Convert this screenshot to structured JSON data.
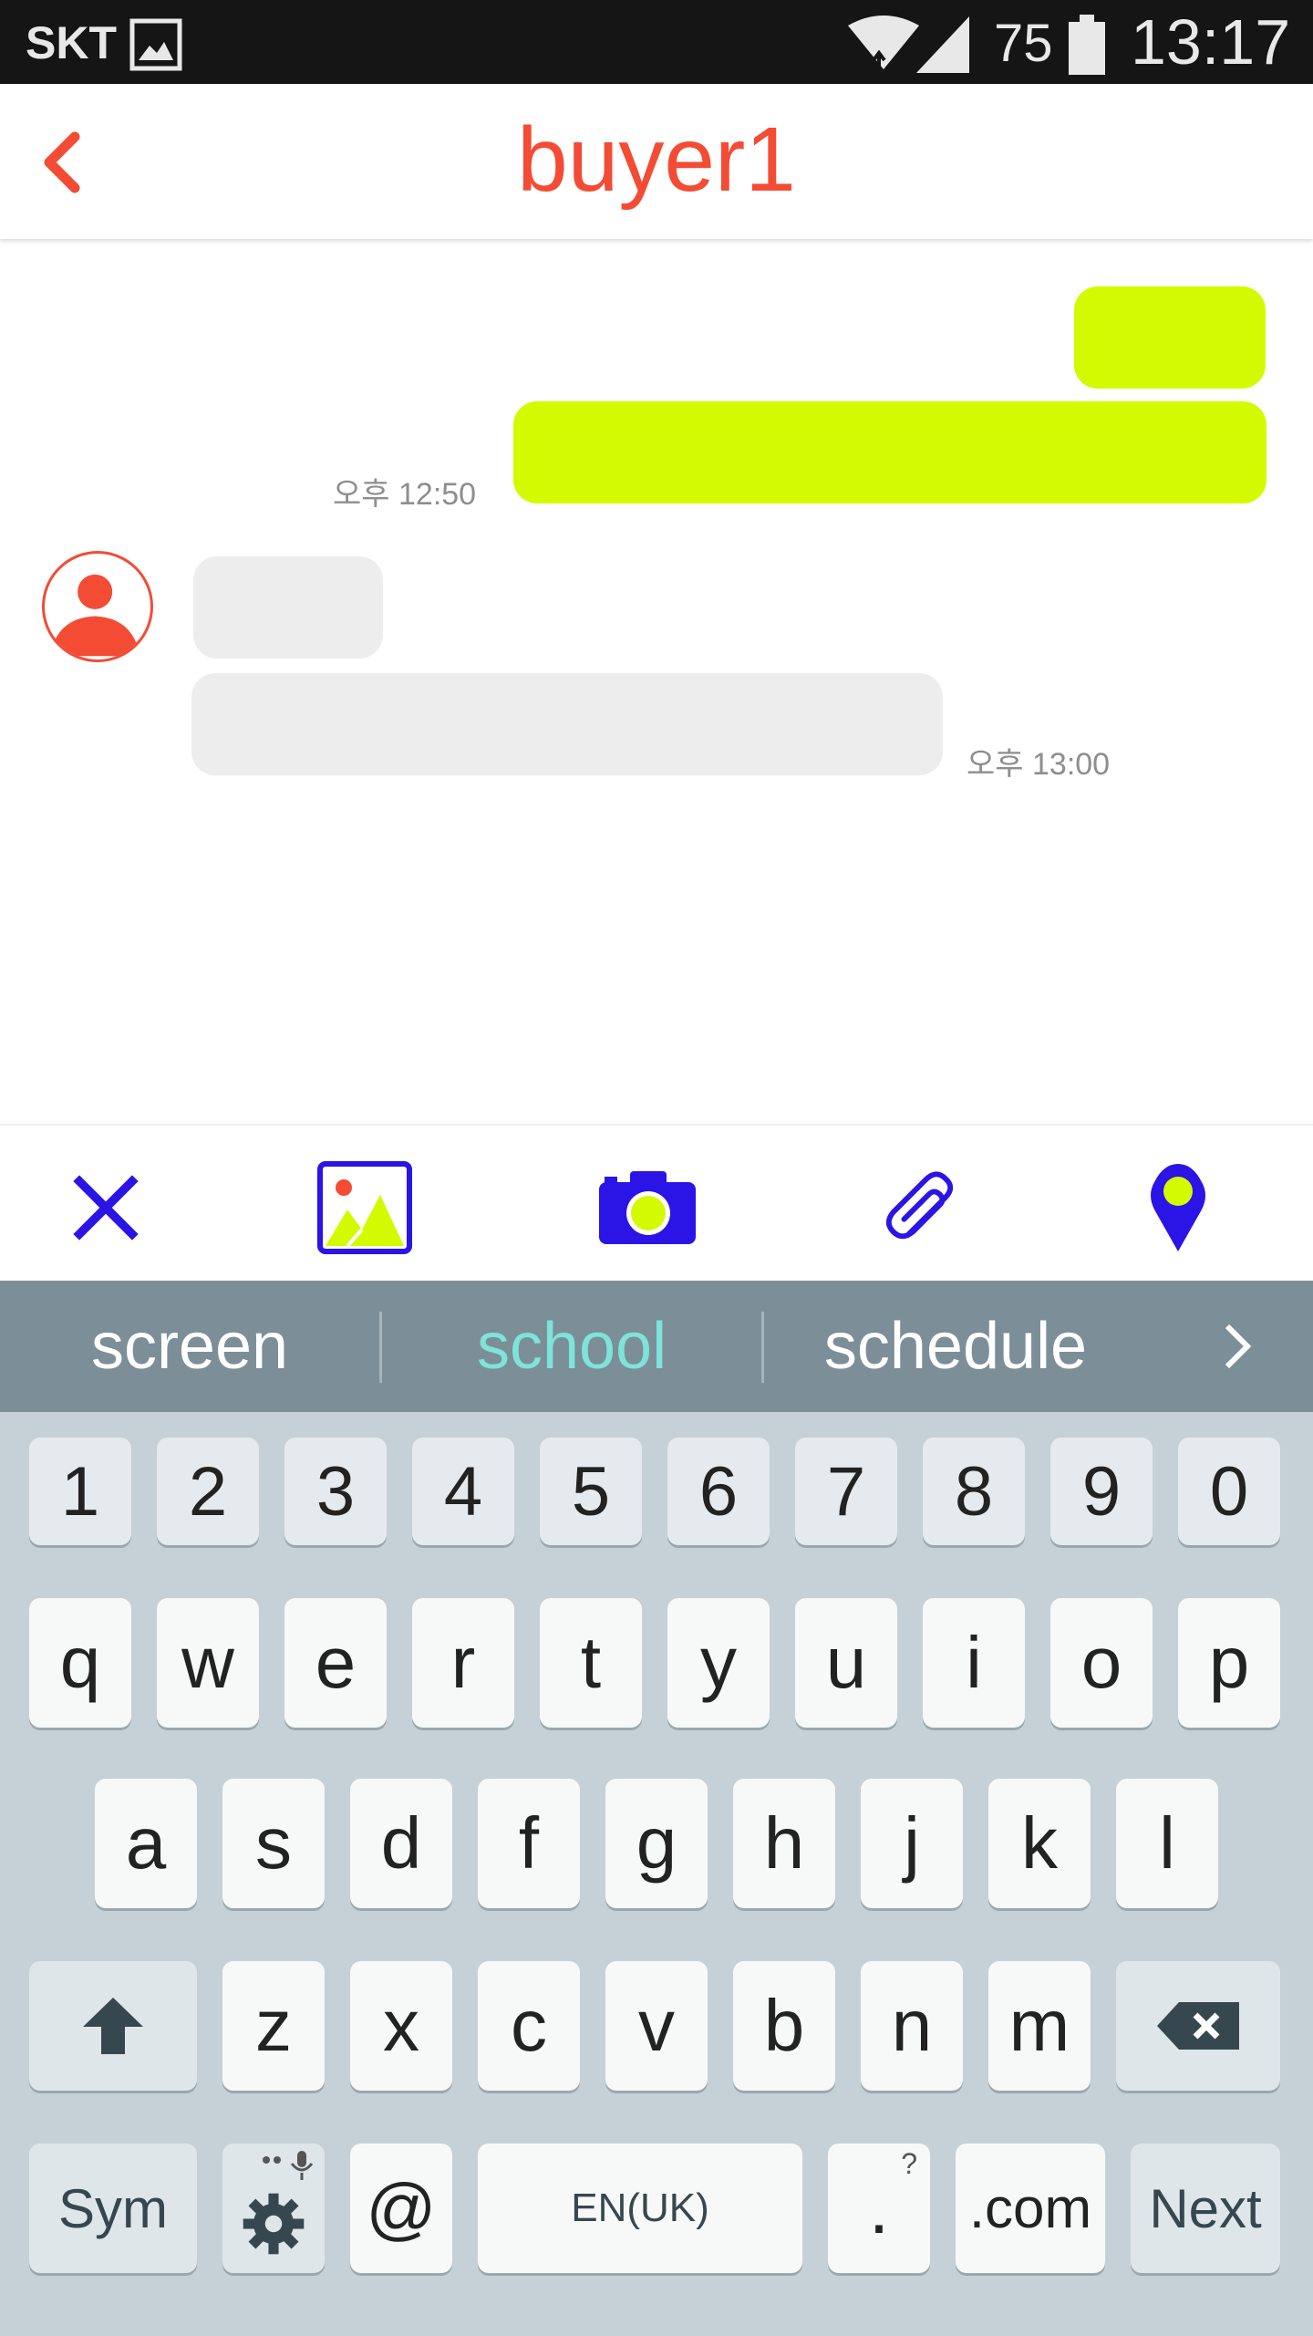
{
  "status_bar": {
    "carrier": "SKT",
    "battery_percent": "75",
    "time": "13:17"
  },
  "header": {
    "title": "buyer1"
  },
  "chat": {
    "outgoing_timestamp": "오후 12:50",
    "incoming_timestamp": "오후 13:00"
  },
  "attachment_bar": {
    "icons": [
      "close-icon",
      "gallery-icon",
      "camera-icon",
      "paperclip-icon",
      "location-pin-icon"
    ],
    "accent": "#2b14e6",
    "highlight": "#d4fa00"
  },
  "suggestions": {
    "items": [
      "screen",
      "school",
      "schedule"
    ]
  },
  "keyboard": {
    "number_row": [
      "1",
      "2",
      "3",
      "4",
      "5",
      "6",
      "7",
      "8",
      "9",
      "0"
    ],
    "row1": [
      "q",
      "w",
      "e",
      "r",
      "t",
      "y",
      "u",
      "i",
      "o",
      "p"
    ],
    "row2": [
      "a",
      "s",
      "d",
      "f",
      "g",
      "h",
      "j",
      "k",
      "l"
    ],
    "row3": [
      "z",
      "x",
      "c",
      "v",
      "b",
      "n",
      "m"
    ],
    "sym_label": "Sym",
    "at_label": "@",
    "space_label": "EN(UK)",
    "period_label": ".",
    "period_sub": "?",
    "com_label": ".com",
    "next_label": "Next"
  },
  "colors": {
    "accent_red": "#f44b35",
    "outgoing_bubble": "#d4fa00",
    "incoming_bubble": "#ededed",
    "suggestion_bar": "#7c8e98",
    "suggestion_active": "#7ee3d9",
    "keyboard_bg": "#c5d1d7"
  }
}
